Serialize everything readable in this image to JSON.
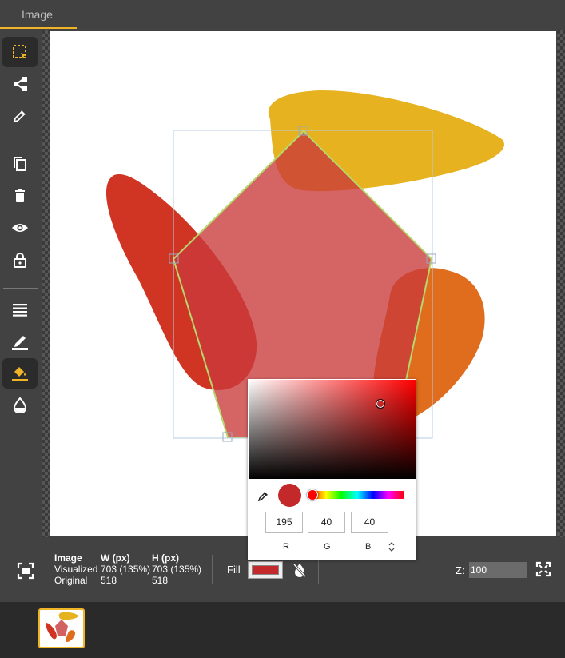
{
  "tab": {
    "label": "Image"
  },
  "toolbar": {
    "tools": [
      "select-icon",
      "share-icon",
      "eyedropper-icon",
      "copy-icon",
      "trash-icon",
      "eye-icon",
      "lock-icon",
      "layers-icon",
      "pencil-icon",
      "fill-bucket-icon",
      "drop-icon"
    ],
    "active_tool": "fill-bucket-icon"
  },
  "canvas": {
    "shapes_colors": {
      "yellow": "#e6b21f",
      "red": "#d03524",
      "orange": "#e06c1e",
      "pentagon": "#d56060",
      "pentagon_stroke": "#b5d96a"
    }
  },
  "info": {
    "label_image": "Image",
    "label_w": "W (px)",
    "label_h": "H (px)",
    "label_visualized": "Visualized",
    "label_original": "Original",
    "vis_w": "703 (135%)",
    "vis_h": "703 (135%)",
    "orig_w": "518",
    "orig_h": "518"
  },
  "fill": {
    "label": "Fill",
    "color": "#c3282a"
  },
  "zoom": {
    "label": "Z:",
    "value": "100"
  },
  "picker": {
    "r": "195",
    "g": "40",
    "b": "40",
    "r_label": "R",
    "g_label": "G",
    "b_label": "B",
    "mode_toggle": "⌃⌄"
  }
}
